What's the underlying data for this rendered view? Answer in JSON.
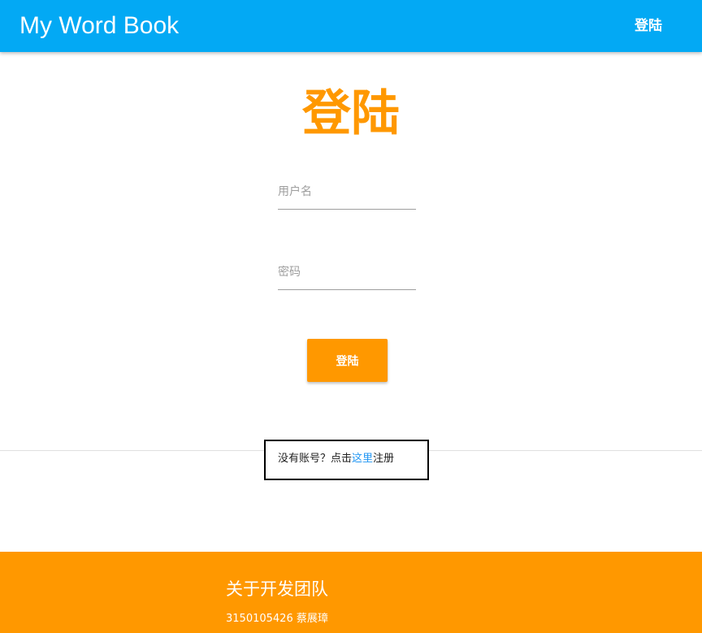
{
  "header": {
    "title": "My Word Book",
    "login_label": "登陆",
    "color": "#03a9f4"
  },
  "login": {
    "heading": "登陆",
    "username_placeholder": "用户名",
    "password_placeholder": "密码",
    "submit_label": "登陆",
    "accent_color": "#ff9800"
  },
  "register": {
    "prefix": "没有账号？点击",
    "link": "这里",
    "suffix": "注册",
    "link_color": "#2196f3"
  },
  "footer": {
    "title": "关于开发团队",
    "members": [
      "3150105426 蔡展璋"
    ],
    "color": "#ff9800"
  }
}
